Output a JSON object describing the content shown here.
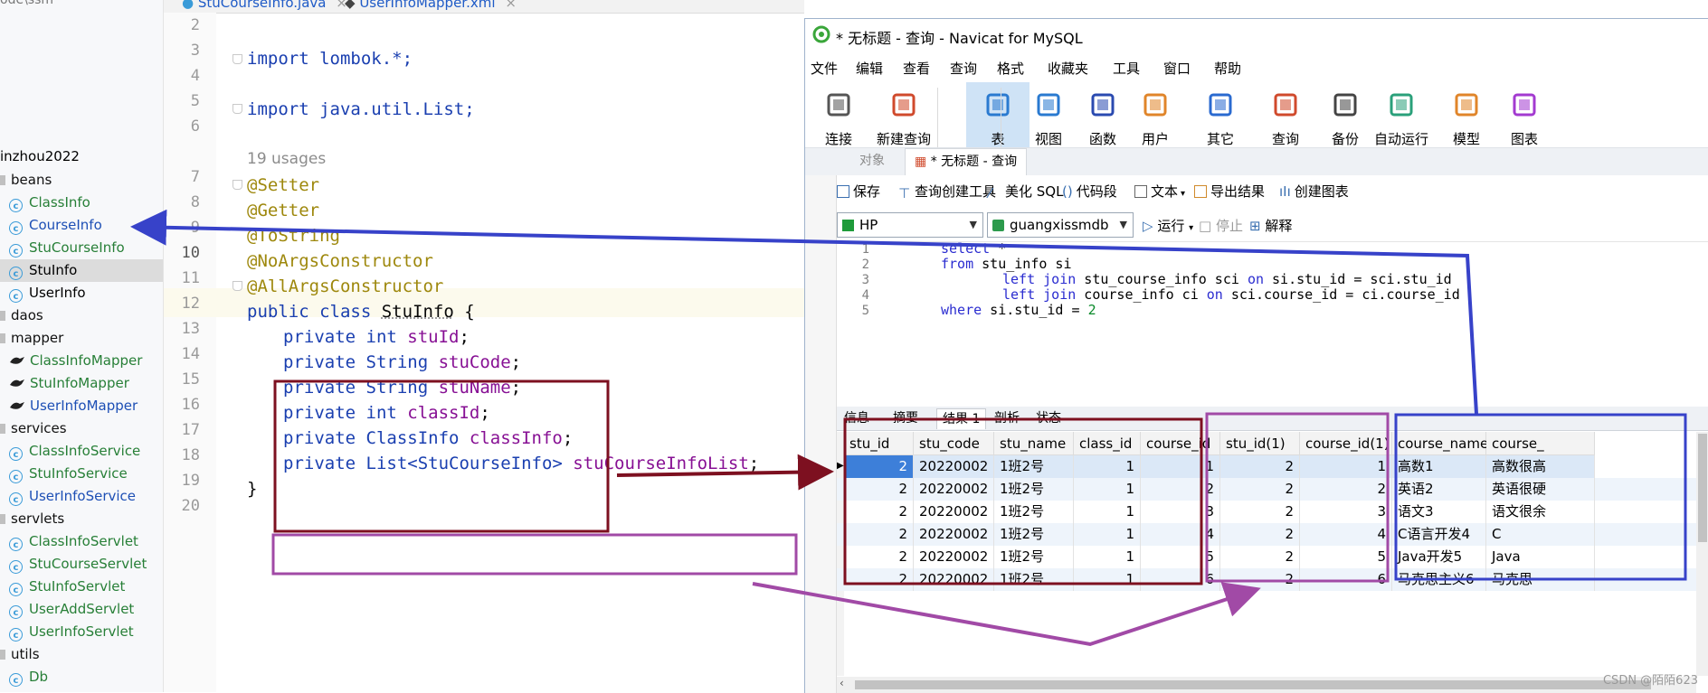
{
  "tree": {
    "top_text": "ode\\ssm",
    "items": [
      {
        "label": "inzhou2022",
        "kind": "pkg-text"
      },
      {
        "label": "beans",
        "kind": "pkg"
      },
      {
        "label": "ClassInfo",
        "kind": "class"
      },
      {
        "label": "CourseInfo",
        "kind": "class"
      },
      {
        "label": "StuCourseInfo",
        "kind": "class"
      },
      {
        "label": "StuInfo",
        "kind": "class",
        "selected": true
      },
      {
        "label": "UserInfo",
        "kind": "class"
      },
      {
        "label": "daos",
        "kind": "pkg"
      },
      {
        "label": "mapper",
        "kind": "pkg"
      },
      {
        "label": "ClassInfoMapper",
        "kind": "mapper"
      },
      {
        "label": "StuInfoMapper",
        "kind": "mapper"
      },
      {
        "label": "UserInfoMapper",
        "kind": "mapper"
      },
      {
        "label": "services",
        "kind": "pkg"
      },
      {
        "label": "ClassInfoService",
        "kind": "class"
      },
      {
        "label": "StuInfoService",
        "kind": "class"
      },
      {
        "label": "UserInfoService",
        "kind": "class"
      },
      {
        "label": "servlets",
        "kind": "pkg"
      },
      {
        "label": "ClassInfoServlet",
        "kind": "class"
      },
      {
        "label": "StuCourseServlet",
        "kind": "class"
      },
      {
        "label": "StuInfoServlet",
        "kind": "class"
      },
      {
        "label": "UserAddServlet",
        "kind": "class"
      },
      {
        "label": "UserInfoServlet",
        "kind": "class"
      },
      {
        "label": "utils",
        "kind": "pkg"
      },
      {
        "label": "Db",
        "kind": "class"
      }
    ]
  },
  "editor": {
    "tabs": [
      "StuCourseInfo.java",
      "UserInfoMapper.xml"
    ],
    "usages": "19 usages",
    "line_numbers": [
      "2",
      "3",
      "4",
      "5",
      "6",
      "7",
      "8",
      "9",
      "10",
      "11",
      "12",
      "13",
      "14",
      "15",
      "16",
      "17",
      "18",
      "19",
      "20"
    ],
    "code": {
      "import1": "import lombok.*;",
      "import2": "import java.util.List;",
      "setter": "@Setter",
      "getter": "@Getter",
      "tostring": "@ToString",
      "noargs": "@NoArgsConstructor",
      "allargs": "@AllArgsConstructor",
      "class_kw": "public class ",
      "class_name": "StuInfo",
      "class_open": " {",
      "f1_type": "private int ",
      "f1_name": "stuId",
      "f2_type": "private String ",
      "f2_name": "stuCode",
      "f3_type": "private String ",
      "f3_name": "stuName",
      "f4_type": "private int ",
      "f4_name": "classId",
      "f5_type": "private ClassInfo ",
      "f5_name": "classInfo",
      "f6_type": "private List<StuCourseInfo> ",
      "f6_name": "stuCourseInfoList",
      "semi": ";",
      "close": "}"
    }
  },
  "navicat": {
    "title": "* 无标题 - 查询 - Navicat for MySQL",
    "menu": [
      "文件",
      "编辑",
      "查看",
      "查询",
      "格式",
      "收藏夹",
      "工具",
      "窗口",
      "帮助"
    ],
    "toolbar": [
      "连接",
      "新建查询",
      "表",
      "视图",
      "函数",
      "用户",
      "其它",
      "查询",
      "备份",
      "自动运行",
      "模型",
      "图表"
    ],
    "tabs": {
      "objects": "对象",
      "query": "* 无标题 - 查询"
    },
    "query_bar": [
      "保存",
      "查询创建工具",
      "美化 SQL",
      "代码段",
      "文本",
      "导出结果",
      "创建图表"
    ],
    "connection": "HP",
    "database": "guangxissmdb",
    "run": "运行",
    "stop": "停止",
    "explain": "解释",
    "sql_lines": [
      "1",
      "2",
      "3",
      "4",
      "5"
    ],
    "sql": {
      "l1_kw": "select",
      "l1_rest": " *",
      "l2_kw": "from",
      "l2_rest": " stu_info si",
      "l3_kw1": "left join",
      "l3_mid": " stu_course_info sci ",
      "l3_kw2": "on",
      "l3_rest": " si.stu_id = sci.stu_id",
      "l4_kw1": "left join",
      "l4_mid": " course_info ci ",
      "l4_kw2": "on",
      "l4_rest": " sci.course_id = ci.course_id",
      "l5_kw": "where",
      "l5_rest": " si.stu_id = ",
      "l5_num": "2"
    },
    "result_tabs": [
      "信息",
      "摘要",
      "结果 1",
      "剖析",
      "状态"
    ],
    "columns": [
      "stu_id",
      "stu_code",
      "stu_name",
      "class_id",
      "course_id",
      "stu_id(1)",
      "course_id(1)",
      "course_name",
      "course_"
    ],
    "rows": [
      [
        "2",
        "20220002",
        "1班2号",
        "1",
        "1",
        "2",
        "1",
        "高数1",
        "高数很高"
      ],
      [
        "2",
        "20220002",
        "1班2号",
        "1",
        "2",
        "2",
        "2",
        "英语2",
        "英语很硬"
      ],
      [
        "2",
        "20220002",
        "1班2号",
        "1",
        "3",
        "2",
        "3",
        "语文3",
        "语文很余"
      ],
      [
        "2",
        "20220002",
        "1班2号",
        "1",
        "4",
        "2",
        "4",
        "C语言开发4",
        "C"
      ],
      [
        "2",
        "20220002",
        "1班2号",
        "1",
        "5",
        "2",
        "5",
        "Java开发5",
        "Java"
      ],
      [
        "2",
        "20220002",
        "1班2号",
        "1",
        "6",
        "2",
        "6",
        "马克思主义6",
        "马克思"
      ]
    ],
    "watermark": "CSDN @陌陌623"
  },
  "colors": {
    "darkred": "#7d1020",
    "purple": "#a14aa6",
    "blue": "#3742c9"
  }
}
